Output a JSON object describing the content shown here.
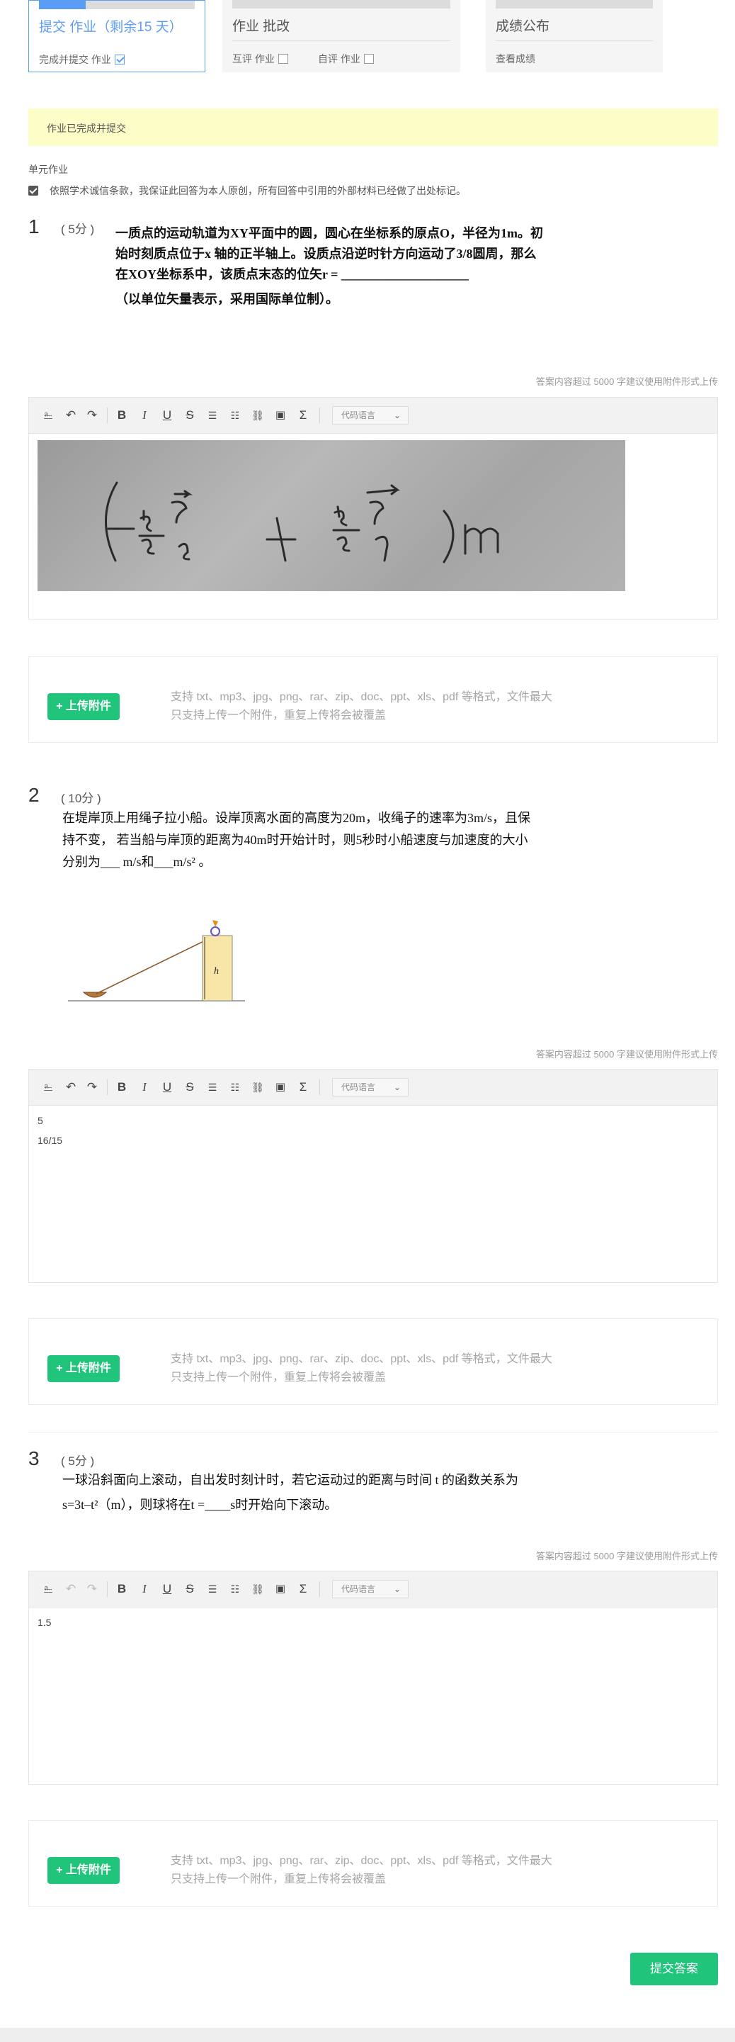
{
  "steps": {
    "submit": {
      "title": "提交 作业（剩余15 天）",
      "sub_label": "完成并提交 作业",
      "checked": true,
      "progress": 0.3
    },
    "grade": {
      "title": "作业 批改",
      "peer_label": "互评 作业",
      "self_label": "自评 作业"
    },
    "publish": {
      "title": "成绩公布",
      "sub_label": "查看成绩"
    }
  },
  "notice": "作业已完成并提交",
  "section_label": "单元作业",
  "integrity": "依照学术诚信条款，我保证此回答为本人原创，所有回答中引用的外部材料已经做了出处标记。",
  "hint": "答案内容超过 5000 字建议使用附件形式上传",
  "lang_select": "代码语言",
  "upload": {
    "button": "+ 上传附件",
    "info_line1": "支持 txt、mp3、jpg、png、rar、zip、doc、ppt、xls、pdf 等格式，文件最大",
    "info_line2": "只支持上传一个附件，重复上传将会被覆盖"
  },
  "questions": [
    {
      "num": "1",
      "score": "( 5分 )",
      "lines": [
        "一质点的运动轨道为XY平面中的圆，圆心在坐标系的原点O，半径为1m。初",
        "始时刻质点位于x 轴的正半轴上。设质点沿逆时针方向运动了3/8圆周，那么",
        "在XOY坐标系中，该质点末态的位矢r = ____________________",
        "（以单位矢量表示，采用国际单位制）。"
      ],
      "answer_lines": []
    },
    {
      "num": "2",
      "score": "( 10分 )",
      "lines": [
        "在堤岸顶上用绳子拉小船。设岸顶离水面的高度为20m，收绳子的速率为3m/s，且保",
        "持不变，  若当船与岸顶的距离为40m时开始计时，则5秒时小船速度与加速度的大小",
        "分别为___ m/s和___m/s² 。"
      ],
      "answer_lines": [
        "5",
        "16/15"
      ]
    },
    {
      "num": "3",
      "score": "( 5分 )",
      "lines": [
        "一球沿斜面向上滚动，自出发时刻计时，若它运动过的距离与时间    t 的函数关系为",
        "s=3t–t²（m），则球将在t =____s时开始向下滚动。"
      ],
      "answer_lines": [
        "1.5"
      ]
    }
  ],
  "submit_button": "提交答案"
}
